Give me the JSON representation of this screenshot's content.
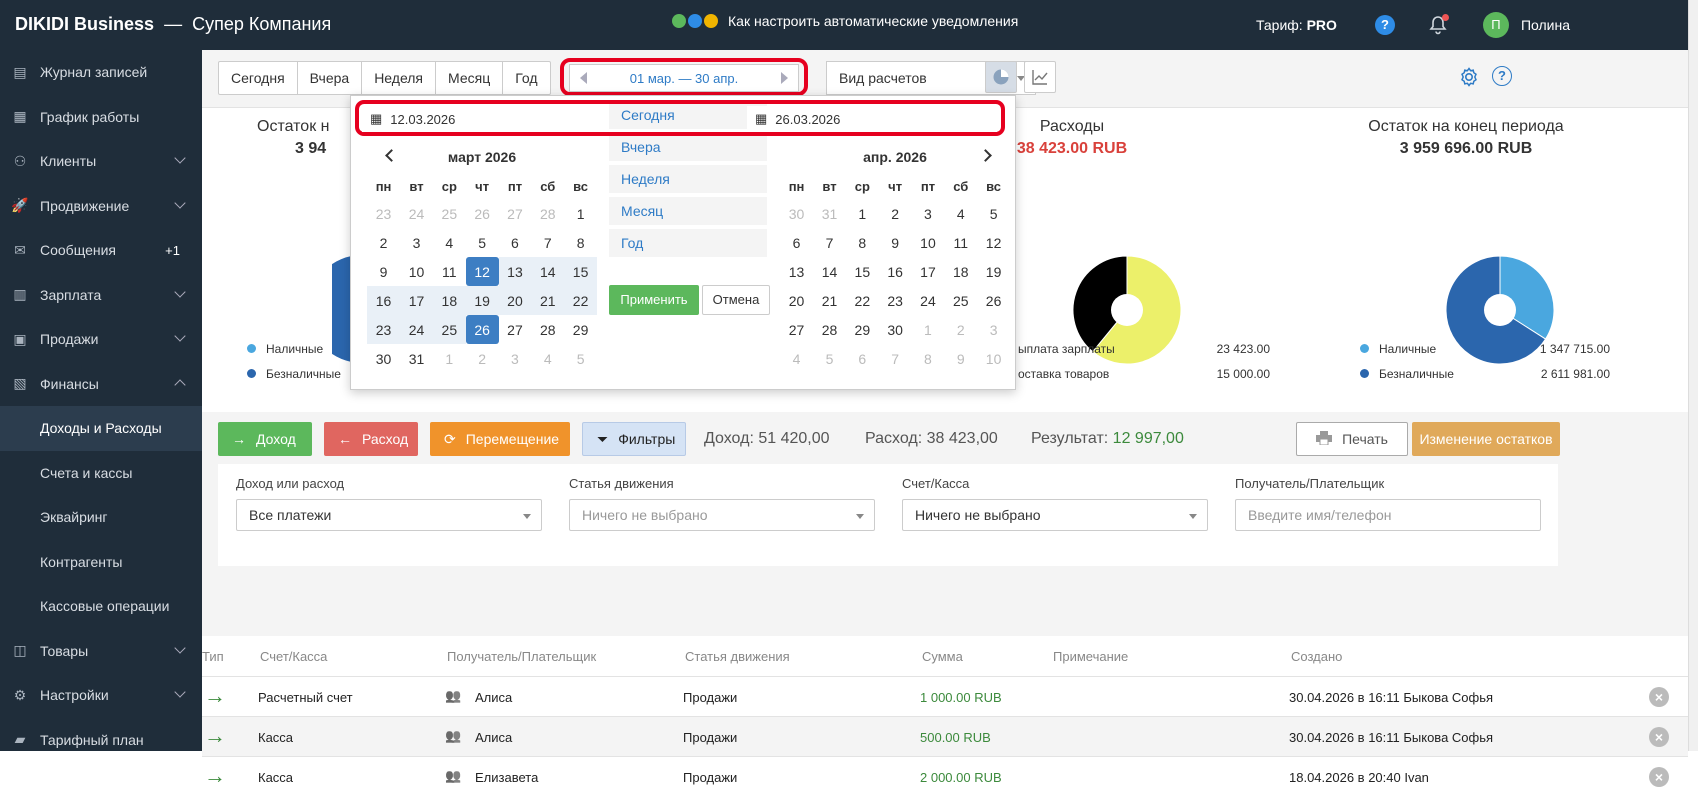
{
  "app": {
    "brand": "DIKIDI Business",
    "separator": "—",
    "company": "Супер Компания"
  },
  "promo": {
    "text": "Как настроить автоматические уведомления"
  },
  "header": {
    "tariff_label": "Тариф:",
    "tariff_value": "PRO",
    "help": "?",
    "avatar_letter": "П",
    "user": "Полина"
  },
  "sidebar": {
    "items": [
      {
        "label": "Журнал записей",
        "icon": "journal-icon"
      },
      {
        "label": "График работы",
        "icon": "calendar-icon"
      },
      {
        "label": "Клиенты",
        "icon": "clients-icon"
      },
      {
        "label": "Продвижение",
        "icon": "rocket-icon"
      },
      {
        "label": "Сообщения",
        "icon": "messages-icon",
        "badge": "+1"
      },
      {
        "label": "Зарплата",
        "icon": "salary-icon"
      },
      {
        "label": "Продажи",
        "icon": "sales-icon"
      },
      {
        "label": "Финансы",
        "icon": "finance-icon"
      },
      {
        "label": "Доходы и Расходы"
      },
      {
        "label": "Счета и кассы"
      },
      {
        "label": "Эквайринг"
      },
      {
        "label": "Контрагенты"
      },
      {
        "label": "Кассовые операции"
      },
      {
        "label": "Товары",
        "icon": "goods-icon"
      },
      {
        "label": "Настройки",
        "icon": "settings-icon"
      },
      {
        "label": "Тарифный план",
        "icon": "tariff-icon"
      }
    ]
  },
  "toolbar": {
    "periods": [
      "Сегодня",
      "Вчера",
      "Неделя",
      "Месяц",
      "Год"
    ],
    "range": "01 мар. — 30 апр.",
    "view_select": "Вид расчетов"
  },
  "stats": {
    "start_label": "Остаток н",
    "start_value": "3 94",
    "expense_label": "Расходы",
    "expense_value": "38 423.00 RUB",
    "end_label": "Остаток на конец периода",
    "end_value": "3 959 696.00 RUB"
  },
  "legend_left": [
    {
      "label": "Наличные",
      "color": "#4aa7df"
    },
    {
      "label": "Безналичные",
      "color": "#2b66ad"
    }
  ],
  "legend_expense": [
    {
      "label": "ыплата зарплаты",
      "amount": "23 423.00"
    },
    {
      "label": "оставка товаров",
      "amount": "15 000.00"
    }
  ],
  "legend_end": [
    {
      "label": "Наличные",
      "amount": "1 347 715.00",
      "color": "#4aa7df"
    },
    {
      "label": "Безналичные",
      "amount": "2 611 981.00",
      "color": "#2b66ad"
    }
  ],
  "pie_expense": {
    "values": [
      23423,
      15000
    ],
    "colors": [
      "#ecf06a",
      "#000000"
    ]
  },
  "pie_end": {
    "values": [
      1347715,
      2611981
    ],
    "colors": [
      "#4aa7df",
      "#2b66ad"
    ]
  },
  "pie_start_colors": [
    "#4aa7df",
    "#2b66ad"
  ],
  "actions": {
    "income": "Доход",
    "expense": "Расход",
    "move": "Перемещение",
    "filters": "Фильтры",
    "income_sum": "Доход: 51 420,00",
    "expense_sum": "Расход: 38 423,00",
    "result_label": "Результат:",
    "result_value": "12 997,00",
    "print": "Печать",
    "change_balance": "Изменение остатков"
  },
  "filters": [
    {
      "label": "Доход или расход",
      "value": "Все платежи",
      "placeholder": false
    },
    {
      "label": "Статья движения",
      "value": "Ничего не выбрано",
      "placeholder": true
    },
    {
      "label": "Счет/Касса",
      "value": "Ничего не выбрано",
      "placeholder": false
    },
    {
      "label": "Получатель/Плательщик",
      "value": "Введите имя/телефон",
      "placeholder": true
    }
  ],
  "table": {
    "headers": [
      "Тип",
      "Счет/Касса",
      "Получатель/Плательщик",
      "Статья движения",
      "Сумма",
      "Примечание",
      "Создано"
    ],
    "rows": [
      {
        "account": "Расчетный счет",
        "payee": "Алиса",
        "article": "Продажи",
        "amount": "1 000.00 RUB",
        "created": "30.04.2026 в 16:11 Быкова Софья"
      },
      {
        "account": "Касса",
        "payee": "Алиса",
        "article": "Продажи",
        "amount": "500.00 RUB",
        "created": "30.04.2026 в 16:11 Быкова Софья"
      },
      {
        "account": "Касса",
        "payee": "Елизавета",
        "article": "Продажи",
        "amount": "2 000.00 RUB",
        "created": "18.04.2026 в 20:40 Ivan"
      }
    ]
  },
  "datepicker": {
    "start": "12.03.2026",
    "end": "26.03.2026",
    "weekdays": [
      "пн",
      "вт",
      "ср",
      "чт",
      "пт",
      "сб",
      "вс"
    ],
    "left": {
      "title": "март 2026",
      "weeks": [
        [
          [
            "23",
            "off"
          ],
          [
            "24",
            "off"
          ],
          [
            "25",
            "off"
          ],
          [
            "26",
            "off"
          ],
          [
            "27",
            "off"
          ],
          [
            "28",
            "off"
          ],
          [
            "1",
            ""
          ]
        ],
        [
          [
            "2",
            ""
          ],
          [
            "3",
            ""
          ],
          [
            "4",
            ""
          ],
          [
            "5",
            ""
          ],
          [
            "6",
            ""
          ],
          [
            "7",
            ""
          ],
          [
            "8",
            ""
          ]
        ],
        [
          [
            "9",
            ""
          ],
          [
            "10",
            ""
          ],
          [
            "11",
            ""
          ],
          [
            "12",
            "sel"
          ],
          [
            "13",
            "in"
          ],
          [
            "14",
            "in"
          ],
          [
            "15",
            "in"
          ]
        ],
        [
          [
            "16",
            "in"
          ],
          [
            "17",
            "in"
          ],
          [
            "18",
            "in"
          ],
          [
            "19",
            "in"
          ],
          [
            "20",
            "in"
          ],
          [
            "21",
            "in"
          ],
          [
            "22",
            "in"
          ]
        ],
        [
          [
            "23",
            "in"
          ],
          [
            "24",
            "in"
          ],
          [
            "25",
            "in"
          ],
          [
            "26",
            "sel"
          ],
          [
            "27",
            ""
          ],
          [
            "28",
            ""
          ],
          [
            "29",
            ""
          ]
        ],
        [
          [
            "30",
            ""
          ],
          [
            "31",
            ""
          ],
          [
            "1",
            "off"
          ],
          [
            "2",
            "off"
          ],
          [
            "3",
            "off"
          ],
          [
            "4",
            "off"
          ],
          [
            "5",
            "off"
          ]
        ]
      ]
    },
    "right": {
      "title": "апр. 2026",
      "weeks": [
        [
          [
            "30",
            "off"
          ],
          [
            "31",
            "off"
          ],
          [
            "1",
            ""
          ],
          [
            "2",
            ""
          ],
          [
            "3",
            ""
          ],
          [
            "4",
            ""
          ],
          [
            "5",
            ""
          ]
        ],
        [
          [
            "6",
            ""
          ],
          [
            "7",
            ""
          ],
          [
            "8",
            ""
          ],
          [
            "9",
            ""
          ],
          [
            "10",
            ""
          ],
          [
            "11",
            ""
          ],
          [
            "12",
            ""
          ]
        ],
        [
          [
            "13",
            ""
          ],
          [
            "14",
            ""
          ],
          [
            "15",
            ""
          ],
          [
            "16",
            ""
          ],
          [
            "17",
            ""
          ],
          [
            "18",
            ""
          ],
          [
            "19",
            ""
          ]
        ],
        [
          [
            "20",
            ""
          ],
          [
            "21",
            ""
          ],
          [
            "22",
            ""
          ],
          [
            "23",
            ""
          ],
          [
            "24",
            ""
          ],
          [
            "25",
            ""
          ],
          [
            "26",
            ""
          ]
        ],
        [
          [
            "27",
            ""
          ],
          [
            "28",
            ""
          ],
          [
            "29",
            ""
          ],
          [
            "30",
            ""
          ],
          [
            "1",
            "off"
          ],
          [
            "2",
            "off"
          ],
          [
            "3",
            "off"
          ]
        ],
        [
          [
            "4",
            "off"
          ],
          [
            "5",
            "off"
          ],
          [
            "6",
            "off"
          ],
          [
            "7",
            "off"
          ],
          [
            "8",
            "off"
          ],
          [
            "9",
            "off"
          ],
          [
            "10",
            "off"
          ]
        ]
      ]
    },
    "presets": [
      "Сегодня",
      "Вчера",
      "Неделя",
      "Месяц",
      "Год"
    ],
    "apply": "Применить",
    "cancel": "Отмена"
  }
}
